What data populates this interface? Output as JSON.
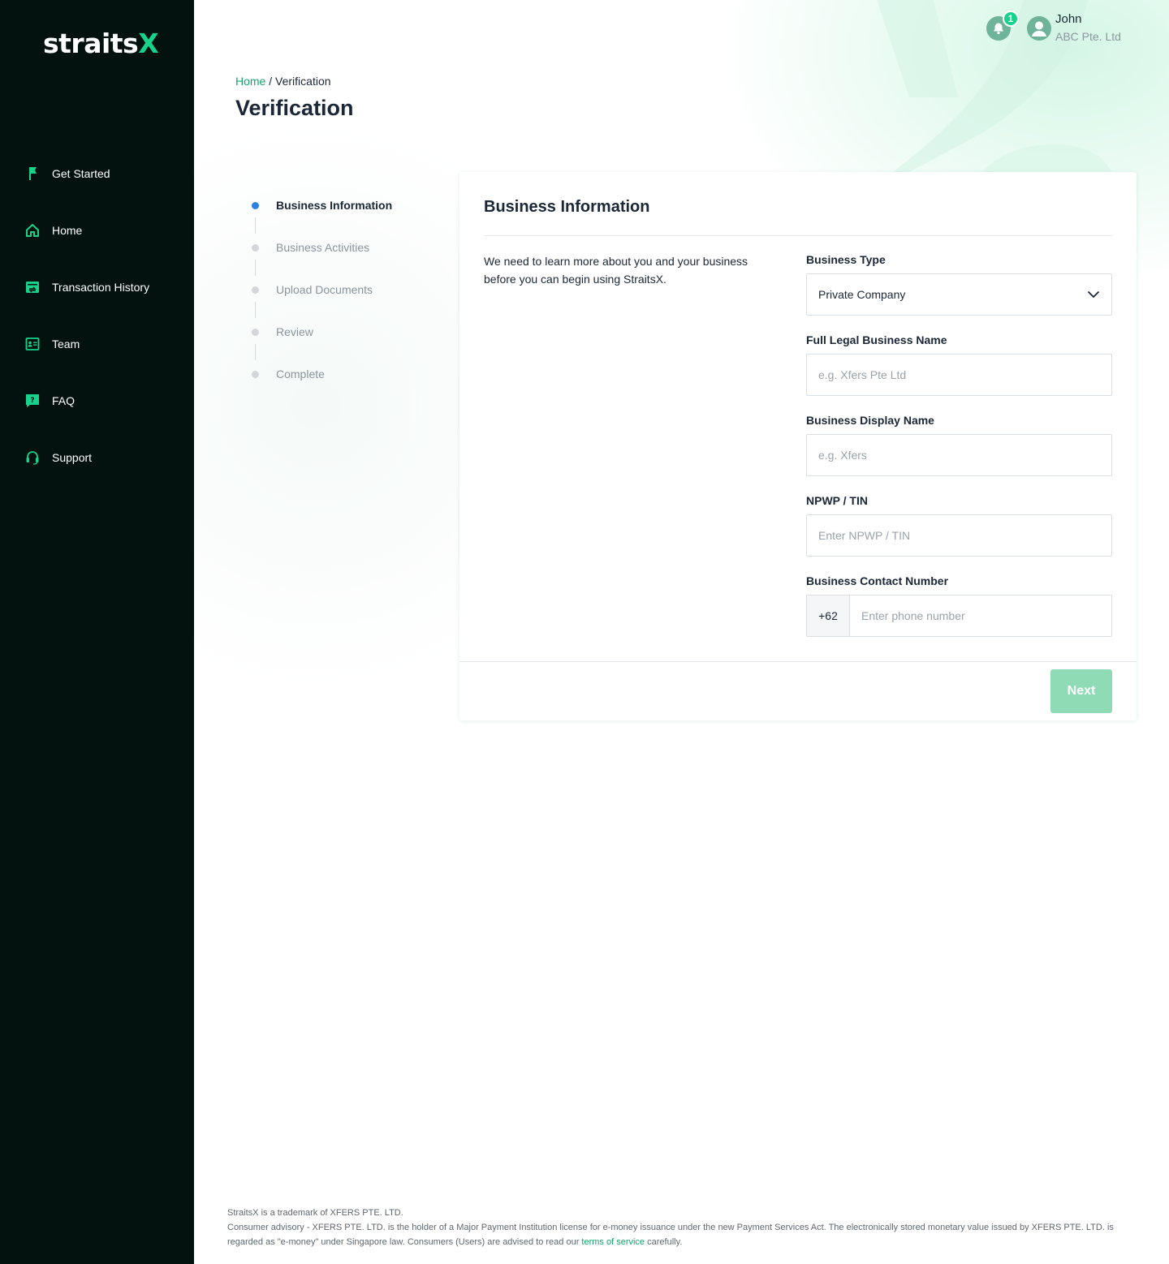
{
  "brand": {
    "logo_main": "straits",
    "logo_accent": "X"
  },
  "sidebar": {
    "items": [
      {
        "label": "Get Started",
        "icon": "flag-icon"
      },
      {
        "label": "Home",
        "icon": "home-icon"
      },
      {
        "label": "Transaction History",
        "icon": "transaction-icon"
      },
      {
        "label": "Team",
        "icon": "team-icon"
      },
      {
        "label": "FAQ",
        "icon": "faq-icon"
      },
      {
        "label": "Support",
        "icon": "headset-icon"
      }
    ]
  },
  "header": {
    "notification_count": "1",
    "user_name": "John",
    "user_company": "ABC Pte. Ltd"
  },
  "breadcrumb": {
    "home": "Home",
    "separator": " / ",
    "current": "Verification"
  },
  "page_title": "Verification",
  "stepper": {
    "active_index": 0,
    "steps": [
      {
        "label": "Business Information"
      },
      {
        "label": "Business Activities"
      },
      {
        "label": "Upload Documents"
      },
      {
        "label": "Review"
      },
      {
        "label": "Complete"
      }
    ]
  },
  "form": {
    "title": "Business Information",
    "description": "We need to learn more about you and your business before you can begin using StraitsX.",
    "business_type": {
      "label": "Business Type",
      "value": "Private Company"
    },
    "legal_name": {
      "label": "Full Legal Business Name",
      "placeholder": "e.g. Xfers Pte Ltd"
    },
    "display_name": {
      "label": "Business Display Name",
      "placeholder": "e.g. Xfers"
    },
    "tin": {
      "label": "NPWP / TIN",
      "placeholder": "Enter NPWP / TIN"
    },
    "contact": {
      "label": "Business Contact Number",
      "prefix": "+62",
      "placeholder": "Enter phone number"
    },
    "next_label": "Next"
  },
  "footer": {
    "line1": "StraitsX is a trademark of XFERS PTE. LTD.",
    "line2_pre": "Consumer advisory - XFERS PTE. LTD. is the holder of a Major Payment Institution license for e-money issuance under the new Payment Services Act. The electronically stored monetary value issued by XFERS PTE. LTD. is regarded as \"e-money\" under Singapore law. Consumers (Users) are advised to read our ",
    "terms_link": "terms of service",
    "line2_post": " carefully."
  },
  "colors": {
    "sidebar_bg": "#04120f",
    "accent_green": "#17d28a",
    "link_green": "#11a36a",
    "step_active": "#2d7fe0",
    "next_disabled": "#8edbb6"
  }
}
